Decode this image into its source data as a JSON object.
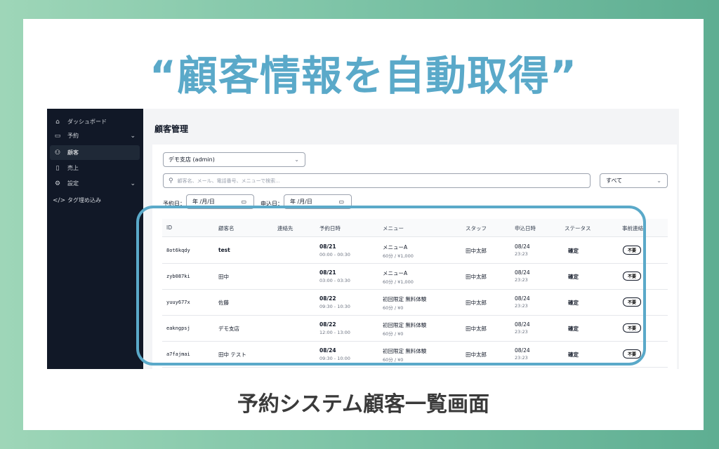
{
  "headline": "“顧客情報を自動取得”",
  "caption": "予約システム顧客一覧画面",
  "sidebar": {
    "items": [
      {
        "icon": "home-icon",
        "glyph": "⌂",
        "label": "ダッシュボード",
        "chevron": false,
        "active": false
      },
      {
        "icon": "calendar-icon",
        "glyph": "▭",
        "label": "予約",
        "chevron": true,
        "active": false
      },
      {
        "icon": "users-icon",
        "glyph": "⚇",
        "label": "顧客",
        "chevron": false,
        "active": true
      },
      {
        "icon": "clipboard-icon",
        "glyph": "▯",
        "label": "売上",
        "chevron": false,
        "active": false
      },
      {
        "icon": "gear-icon",
        "glyph": "⚙",
        "label": "設定",
        "chevron": true,
        "active": false
      },
      {
        "icon": "code-icon",
        "glyph": "</>",
        "label": "タグ埋め込み",
        "chevron": false,
        "active": false
      }
    ]
  },
  "main": {
    "title": "顧客管理",
    "store_select": "デモ支店 (admin)",
    "search_placeholder": "顧客名、メール、電話番号、メニューで検索...",
    "status_select": "すべて",
    "reserve_date_label": "予約日：",
    "apply_date_label": "申込日：",
    "date_placeholder": "年 /月/日"
  },
  "table": {
    "headers": [
      "ID",
      "顧客名",
      "連絡先",
      "予約日時",
      "メニュー",
      "スタッフ",
      "申込日時",
      "ステータス",
      "事前連絡"
    ],
    "rows": [
      {
        "id": "8ot6kqdy",
        "name": "test",
        "name_bold": true,
        "date": "08/21",
        "time": "00:00 - 00:30",
        "menu": "メニューA",
        "menu_sub": "60分 / ¥1,000",
        "staff": "田中太郎",
        "applied_date": "08/24",
        "applied_time": "23:23",
        "status": "確定",
        "precontact": "不要"
      },
      {
        "id": "zyb087ki",
        "name": "田中",
        "name_bold": false,
        "date": "08/21",
        "time": "03:00 - 03:30",
        "menu": "メニューA",
        "menu_sub": "60分 / ¥1,000",
        "staff": "田中太郎",
        "applied_date": "08/24",
        "applied_time": "23:23",
        "status": "確定",
        "precontact": "不要"
      },
      {
        "id": "yuuy677x",
        "name": "佐藤",
        "name_bold": false,
        "date": "08/22",
        "time": "09:30 - 10:30",
        "menu": "初回限定 無料体験",
        "menu_sub": "60分 / ¥0",
        "staff": "田中太郎",
        "applied_date": "08/24",
        "applied_time": "23:23",
        "status": "確定",
        "precontact": "不要"
      },
      {
        "id": "eakngpsj",
        "name": "デモ支店",
        "name_bold": false,
        "date": "08/22",
        "time": "12:00 - 13:00",
        "menu": "初回限定 無料体験",
        "menu_sub": "60分 / ¥0",
        "staff": "田中太郎",
        "applied_date": "08/24",
        "applied_time": "23:23",
        "status": "確定",
        "precontact": "不要"
      },
      {
        "id": "a7fajmai",
        "name": "田中 テスト",
        "name_bold": false,
        "date": "08/24",
        "time": "09:30 - 10:00",
        "menu": "初回限定 無料体験",
        "menu_sub": "60分 / ¥0",
        "staff": "田中太郎",
        "applied_date": "08/24",
        "applied_time": "23:23",
        "status": "確定",
        "precontact": "不要"
      }
    ]
  },
  "colors": {
    "accent": "#5aa9c9",
    "sidebar": "#111827",
    "background_gradient": [
      "#9ed6b8",
      "#5eae92"
    ]
  }
}
